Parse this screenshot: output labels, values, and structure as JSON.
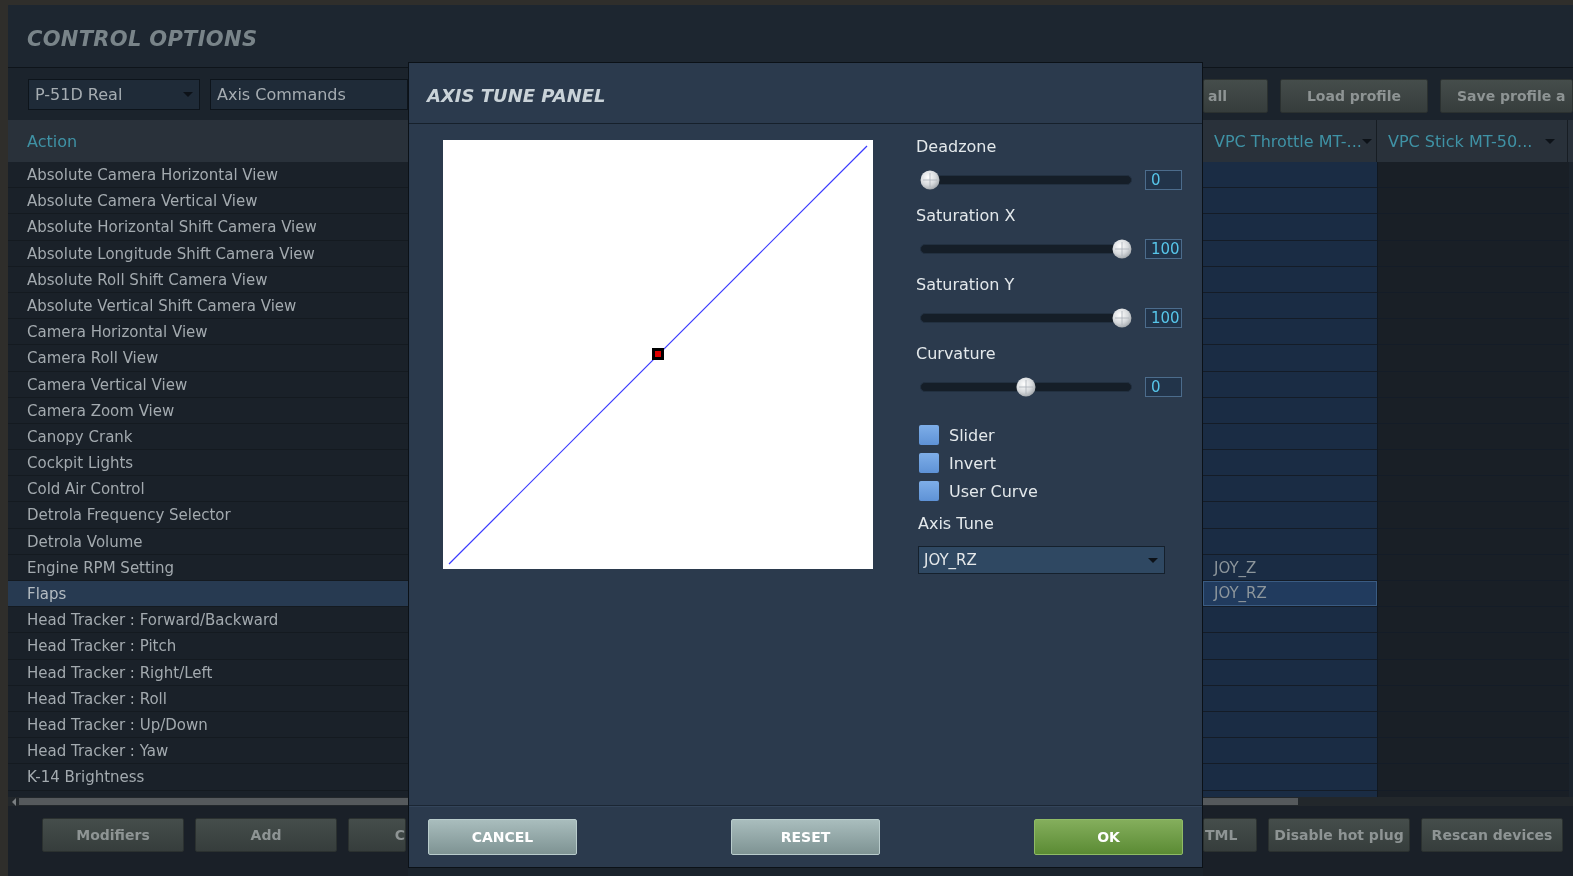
{
  "window": {
    "title": "CONTROL OPTIONS"
  },
  "toolbar": {
    "aircraft": "P-51D Real",
    "category": "Axis Commands",
    "right_buttons": [
      "all",
      "Load profile",
      "Save profile a"
    ]
  },
  "table": {
    "columns": [
      {
        "label": "Action",
        "dropdown": false
      },
      {
        "label": "VPC Throttle MT-...",
        "dropdown": true
      },
      {
        "label": "VPC Stick MT-50...",
        "dropdown": true
      }
    ],
    "rows": [
      {
        "action": "Absolute Camera Horizontal View",
        "selected": false
      },
      {
        "action": "Absolute Camera Vertical View",
        "selected": false
      },
      {
        "action": "Absolute Horizontal Shift Camera View",
        "selected": false
      },
      {
        "action": "Absolute Longitude Shift Camera View",
        "selected": false
      },
      {
        "action": "Absolute Roll Shift Camera View",
        "selected": false
      },
      {
        "action": "Absolute Vertical Shift Camera View",
        "selected": false
      },
      {
        "action": "Camera Horizontal View",
        "selected": false
      },
      {
        "action": "Camera Roll View",
        "selected": false
      },
      {
        "action": "Camera Vertical View",
        "selected": false
      },
      {
        "action": "Camera Zoom View",
        "selected": false
      },
      {
        "action": "Canopy Crank",
        "selected": false
      },
      {
        "action": "Cockpit Lights",
        "selected": false
      },
      {
        "action": "Cold Air Control",
        "selected": false
      },
      {
        "action": "Detrola Frequency Selector",
        "selected": false
      },
      {
        "action": "Detrola Volume",
        "selected": false
      },
      {
        "action": "Engine RPM Setting",
        "selected": false,
        "vpc_throttle": "JOY_Z"
      },
      {
        "action": "Flaps",
        "selected": true,
        "vpc_throttle": "JOY_RZ"
      },
      {
        "action": "Head Tracker : Forward/Backward",
        "selected": false
      },
      {
        "action": "Head Tracker : Pitch",
        "selected": false
      },
      {
        "action": "Head Tracker : Right/Left",
        "selected": false
      },
      {
        "action": "Head Tracker : Roll",
        "selected": false
      },
      {
        "action": "Head Tracker : Up/Down",
        "selected": false
      },
      {
        "action": "Head Tracker : Yaw",
        "selected": false
      },
      {
        "action": "K-14 Brightness",
        "selected": false
      }
    ]
  },
  "bottom_bar": {
    "left_buttons": [
      "Modifiers",
      "Add",
      "C"
    ],
    "right_buttons": [
      "TML",
      "Disable hot plug",
      "Rescan devices"
    ]
  },
  "dialog": {
    "title": "AXIS TUNE PANEL",
    "sliders": [
      {
        "label": "Deadzone",
        "level": 0,
        "value": "0"
      },
      {
        "label": "Saturation X",
        "level": 1,
        "value": "100"
      },
      {
        "label": "Saturation Y",
        "level": 1,
        "value": "100"
      },
      {
        "label": "Curvature",
        "level": 0.5,
        "value": "0"
      }
    ],
    "checkboxes": [
      {
        "label": "Slider",
        "checked": false
      },
      {
        "label": "Invert",
        "checked": false
      },
      {
        "label": "User Curve",
        "checked": false
      }
    ],
    "axis_tune": {
      "label": "Axis Tune",
      "value": "JOY_RZ"
    },
    "buttons": [
      {
        "label": "CANCEL",
        "kind": "secondary"
      },
      {
        "label": "RESET",
        "kind": "secondary"
      },
      {
        "label": "OK",
        "kind": "primary"
      }
    ]
  }
}
